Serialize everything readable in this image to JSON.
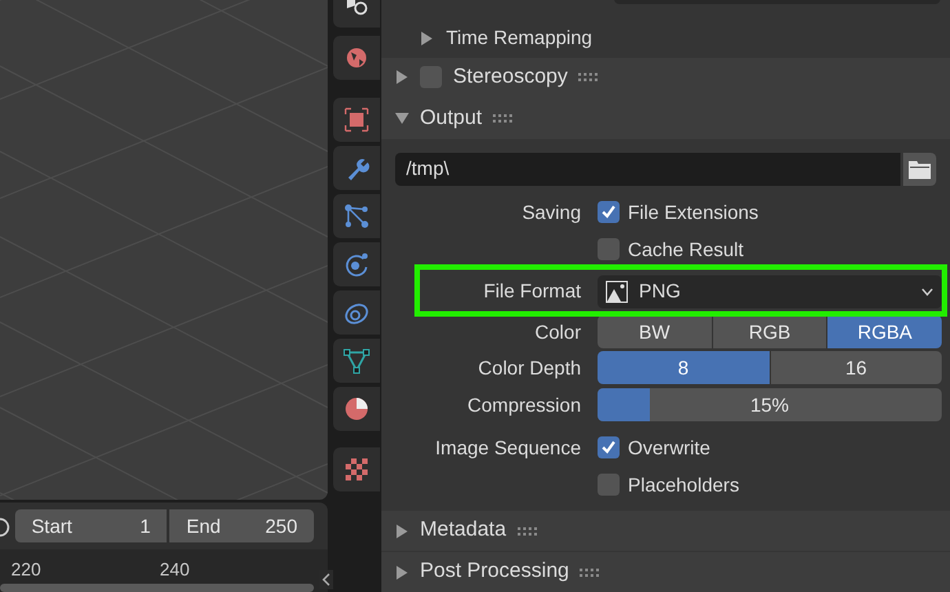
{
  "viewport": {
    "timeline": {
      "start_label": "Start",
      "start": "1",
      "end_label": "End",
      "end": "250"
    },
    "ruler": [
      "220",
      "240"
    ]
  },
  "panels_top": [
    {
      "kind": "subpanel",
      "label": "Time Remapping",
      "expanded": false
    },
    {
      "kind": "panel",
      "label": "Stereoscopy",
      "expanded": false,
      "checked": false
    },
    {
      "kind": "panel",
      "label": "Output",
      "expanded": true
    }
  ],
  "output": {
    "path": "/tmp\\",
    "saving": {
      "label": "Saving",
      "options": [
        {
          "label": "File Extensions",
          "checked": true
        },
        {
          "label": "Cache Result",
          "checked": false
        }
      ]
    },
    "file_format": {
      "label": "File Format",
      "value": "PNG"
    },
    "color": {
      "label": "Color",
      "options": [
        {
          "label": "BW",
          "selected": false
        },
        {
          "label": "RGB",
          "selected": false
        },
        {
          "label": "RGBA",
          "selected": true
        }
      ]
    },
    "color_depth": {
      "label": "Color Depth",
      "options": [
        {
          "label": "8",
          "selected": true
        },
        {
          "label": "16",
          "selected": false
        }
      ]
    },
    "compression": {
      "label": "Compression",
      "level": 0.15,
      "reading": "15%"
    },
    "image_sequence": {
      "label": "Image Sequence",
      "options": [
        {
          "label": "Overwrite",
          "checked": true
        },
        {
          "label": "Placeholders",
          "checked": false
        }
      ]
    }
  },
  "panels_bottom": [
    {
      "kind": "panel",
      "label": "Metadata",
      "expanded": false
    },
    {
      "kind": "panel",
      "label": "Post Processing",
      "expanded": false
    }
  ]
}
